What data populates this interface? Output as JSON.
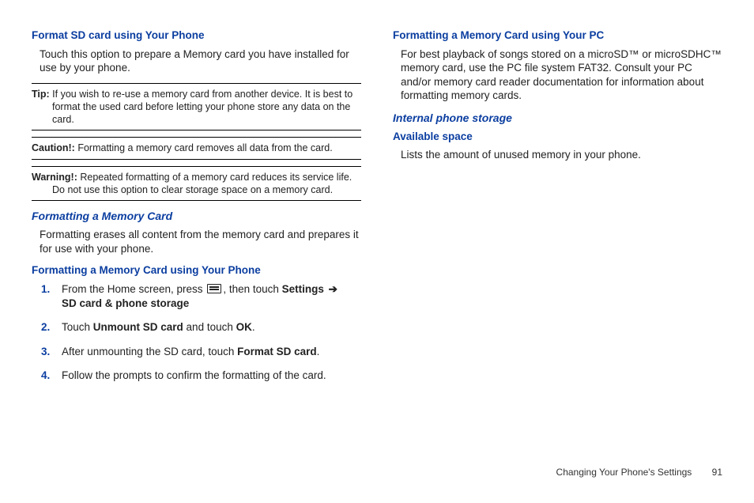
{
  "left": {
    "h1": "Format SD card using Your Phone",
    "p1": "Touch this option to prepare a Memory card you have installed for use by your phone.",
    "tip_label": "Tip:",
    "tip": "If you wish to re-use a memory card from another device. It is best to format the used card before letting your phone store any data on the card.",
    "caution_label": "Caution!:",
    "caution": "Formatting a memory card removes all data from the card.",
    "warning_label": "Warning!:",
    "warning": "Repeated formatting of a memory card reduces its service life. Do not use this option to clear storage space on a memory card.",
    "h2": "Formatting a Memory Card",
    "p2": "Formatting erases all content from the memory card and prepares it for use with your phone.",
    "h3": "Formatting a Memory Card using Your Phone",
    "step1_a": "From the Home screen, press ",
    "step1_b": ", then touch ",
    "step1_settings": "Settings",
    "step1_arrow": "➔",
    "step1_sd": "SD card & phone storage",
    "step2_a": "Touch ",
    "step2_b": "Unmount SD card",
    "step2_c": " and touch ",
    "step2_d": "OK",
    "step2_e": ".",
    "step3_a": "After unmounting the SD card, touch ",
    "step3_b": "Format SD card",
    "step3_c": ".",
    "step4": "Follow the prompts to confirm the formatting of the card."
  },
  "right": {
    "h1": "Formatting a Memory Card using Your PC",
    "p1": "For best playback of songs stored on a microSD™ or microSDHC™ memory card, use the PC file system FAT32. Consult your PC and/or memory card reader documentation for information about formatting memory cards.",
    "h2": "Internal phone storage",
    "h3": "Available space",
    "p2": "Lists the amount of unused memory in your phone."
  },
  "footer": {
    "section": "Changing Your Phone's Settings",
    "page": "91"
  }
}
